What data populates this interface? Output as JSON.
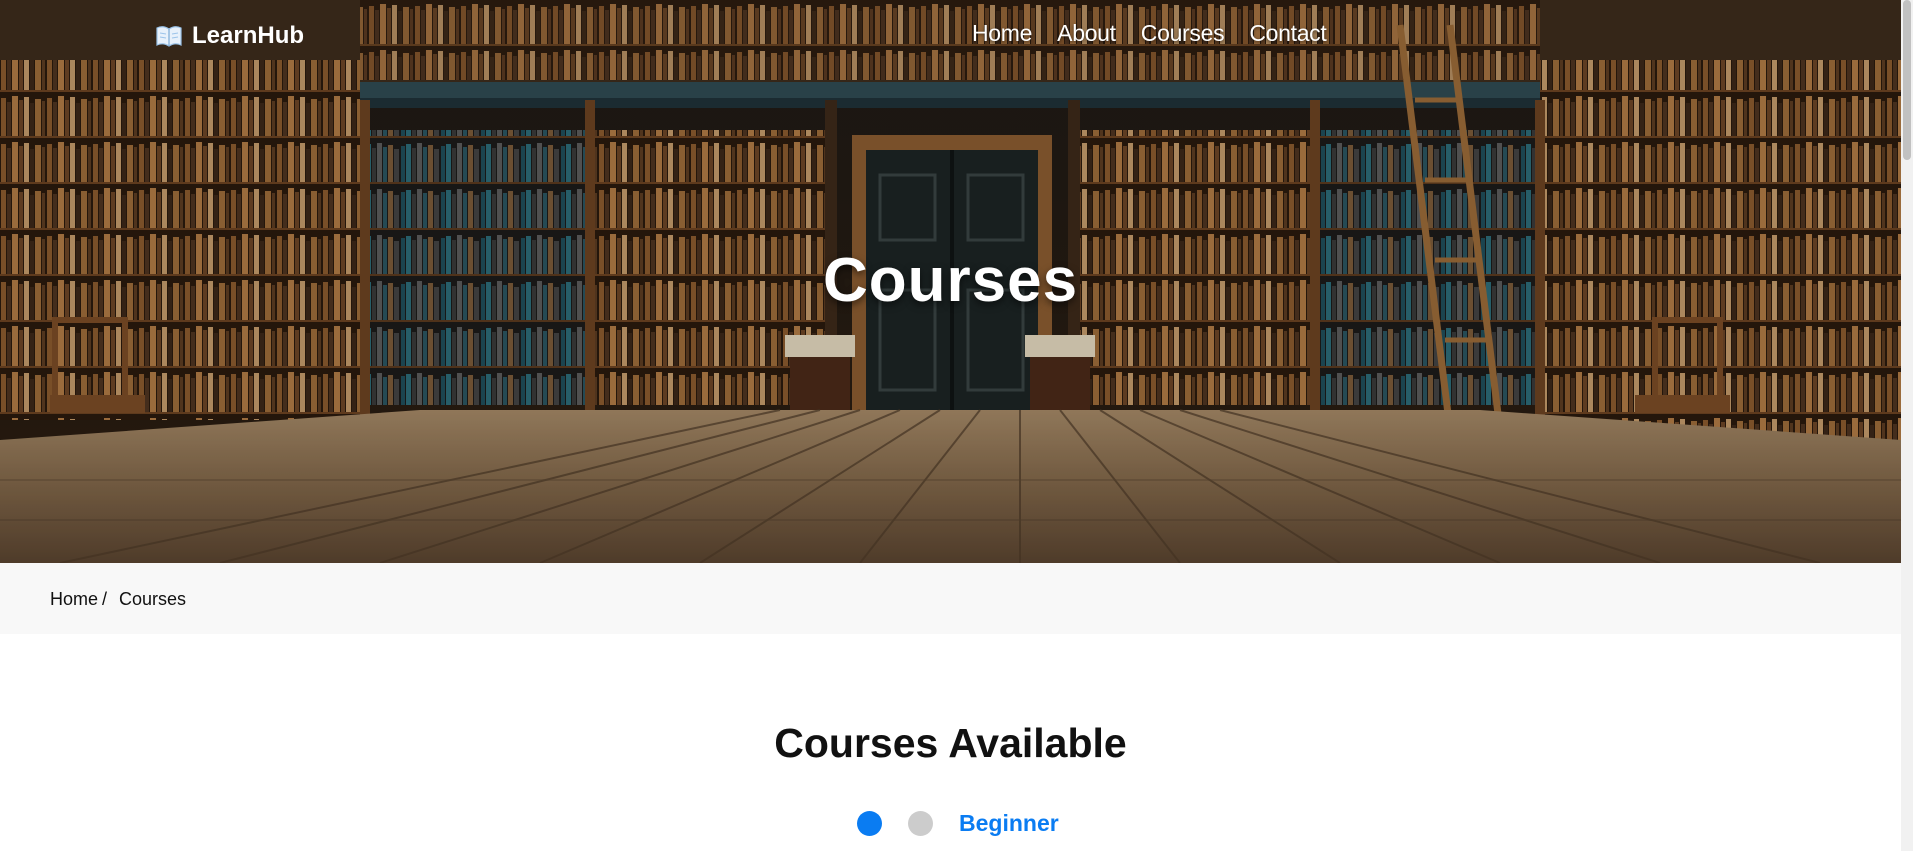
{
  "brand": {
    "icon": "open-book-icon",
    "name": "LearnHub"
  },
  "nav": {
    "items": [
      {
        "label": "Home"
      },
      {
        "label": "About"
      },
      {
        "label": "Courses"
      },
      {
        "label": "Contact"
      }
    ]
  },
  "hero": {
    "title": "Courses"
  },
  "breadcrumb": {
    "home": "Home",
    "separator": "/",
    "current": "Courses"
  },
  "main": {
    "section_title": "Courses Available",
    "level_filter": {
      "selected_index": 0,
      "label": "Beginner"
    }
  },
  "colors": {
    "accent": "#0a7cf2",
    "inactive_dot": "#cccccc",
    "breadcrumb_bg": "#f8f8f8"
  }
}
